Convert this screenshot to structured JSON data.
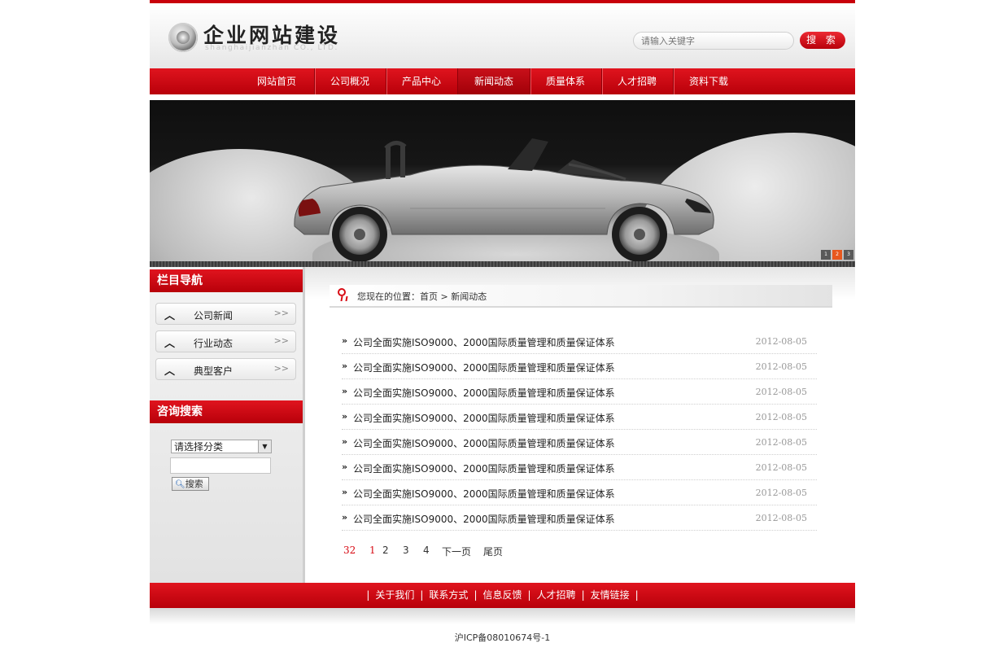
{
  "header": {
    "logo_title": "企业网站建设",
    "logo_subtitle": "shanghaijianzhan CO., LTD.",
    "search_placeholder": "请输入关键字",
    "search_button": "搜 索"
  },
  "nav": {
    "items": [
      "网站首页",
      "公司概况",
      "产品中心",
      "新闻动态",
      "质量体系",
      "人才招聘",
      "资料下载"
    ],
    "active": "新闻动态"
  },
  "banner": {
    "dots": [
      "1",
      "2",
      "3"
    ],
    "active_dot": "2"
  },
  "sidebar": {
    "nav_title": "栏目导航",
    "items": [
      "公司新闻",
      "行业动态",
      "典型客户"
    ],
    "search_title": "咨询搜索",
    "select_value": "请选择分类",
    "search_button": "搜索"
  },
  "main": {
    "breadcrumb": "您现在的位置：首页 > 新闻动态",
    "news": [
      {
        "title": "公司全面实施ISO9000、2000国际质量管理和质量保证体系",
        "date": "2012-08-05"
      },
      {
        "title": "公司全面实施ISO9000、2000国际质量管理和质量保证体系",
        "date": "2012-08-05"
      },
      {
        "title": "公司全面实施ISO9000、2000国际质量管理和质量保证体系",
        "date": "2012-08-05"
      },
      {
        "title": "公司全面实施ISO9000、2000国际质量管理和质量保证体系",
        "date": "2012-08-05"
      },
      {
        "title": "公司全面实施ISO9000、2000国际质量管理和质量保证体系",
        "date": "2012-08-05"
      },
      {
        "title": "公司全面实施ISO9000、2000国际质量管理和质量保证体系",
        "date": "2012-08-05"
      },
      {
        "title": "公司全面实施ISO9000、2000国际质量管理和质量保证体系",
        "date": "2012-08-05"
      },
      {
        "title": "公司全面实施ISO9000、2000国际质量管理和质量保证体系",
        "date": "2012-08-05"
      }
    ],
    "pager": {
      "total": "32",
      "current": "1",
      "pages": [
        "2",
        "3",
        "4"
      ],
      "next": "下一页",
      "last": "尾页"
    }
  },
  "footer": {
    "links": [
      "关于我们",
      "联系方式",
      "信息反馈",
      "人才招聘",
      "友情链接"
    ],
    "separator": "|",
    "icp": "沪ICP备08010674号-1"
  },
  "colors": {
    "brand_red": "#c8000a",
    "accent_red": "#d80b14",
    "date_grey": "#999999"
  }
}
